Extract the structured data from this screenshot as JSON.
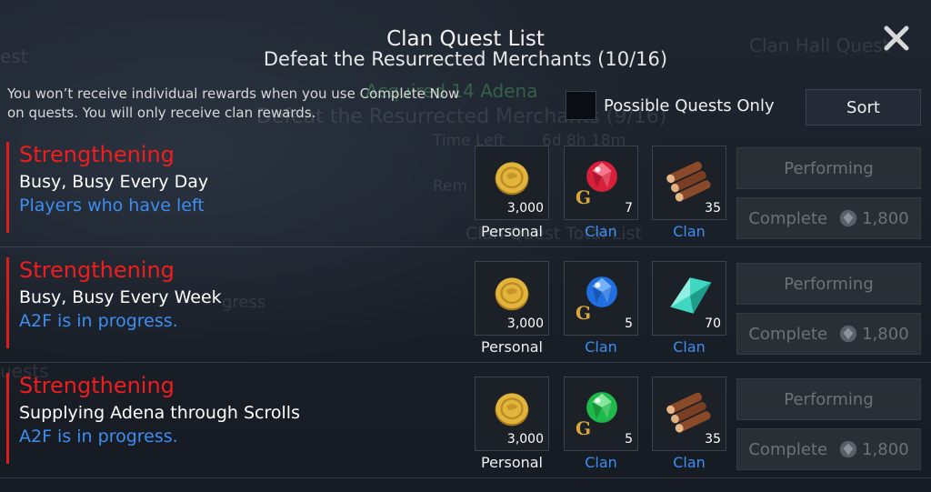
{
  "header": {
    "title": "Clan Quest List",
    "subtitle": "Defeat the Resurrected Merchants (10/16)"
  },
  "notice": {
    "line1": "You won’t receive individual rewards when you use Complete Now",
    "line2": "on quests. You will only receive clan rewards."
  },
  "filter": {
    "label": "Possible Quests Only",
    "checked": false
  },
  "sort": {
    "label": "Sort"
  },
  "background_text": {
    "a": "est",
    "b": "Clan Hall Quest",
    "c": "Acquired 14 Adena",
    "d": "Defeat the Resurrected Merchants (9/16)",
    "e": "Time Left",
    "f": "6d 8h 18m",
    "g": "Rem",
    "h": "Clan Quest Total List",
    "i": "gress",
    "j": "uests"
  },
  "quests": [
    {
      "category": "Strengthening",
      "name": "Busy, Busy Every Day",
      "status": "Players who have left",
      "rewards": [
        {
          "icon": "adena-coin-icon",
          "qty": "3,000",
          "label": "Personal"
        },
        {
          "icon": "red-gem-icon",
          "qty": "7",
          "label": "Clan"
        },
        {
          "icon": "log-bundle-icon",
          "qty": "35",
          "label": "Clan"
        }
      ],
      "perform_label": "Performing",
      "complete_label": "Complete",
      "complete_cost": "1,800"
    },
    {
      "category": "Strengthening",
      "name": "Busy, Busy Every Week",
      "status": "A2F is in progress.",
      "rewards": [
        {
          "icon": "adena-coin-icon",
          "qty": "3,000",
          "label": "Personal"
        },
        {
          "icon": "blue-gem-icon",
          "qty": "5",
          "label": "Clan"
        },
        {
          "icon": "crystal-shard-icon",
          "qty": "70",
          "label": "Clan"
        }
      ],
      "perform_label": "Performing",
      "complete_label": "Complete",
      "complete_cost": "1,800"
    },
    {
      "category": "Strengthening",
      "name": "Supplying Adena through Scrolls",
      "status": "A2F is in progress.",
      "rewards": [
        {
          "icon": "adena-coin-icon",
          "qty": "3,000",
          "label": "Personal"
        },
        {
          "icon": "green-gem-icon",
          "qty": "5",
          "label": "Clan"
        },
        {
          "icon": "log-bundle-icon",
          "qty": "35",
          "label": "Clan"
        }
      ],
      "perform_label": "Performing",
      "complete_label": "Complete",
      "complete_cost": "1,800"
    }
  ],
  "gem_mark": "G",
  "colors": {
    "category": "#f01d1d",
    "status": "#3d8ef0",
    "clan_label": "#3d8ef0",
    "coin": "#e2b43c",
    "red_gem": "#d8203a",
    "blue_gem": "#1f6fe0",
    "green_gem": "#1fb84a",
    "crystal": "#3fd6c2"
  }
}
